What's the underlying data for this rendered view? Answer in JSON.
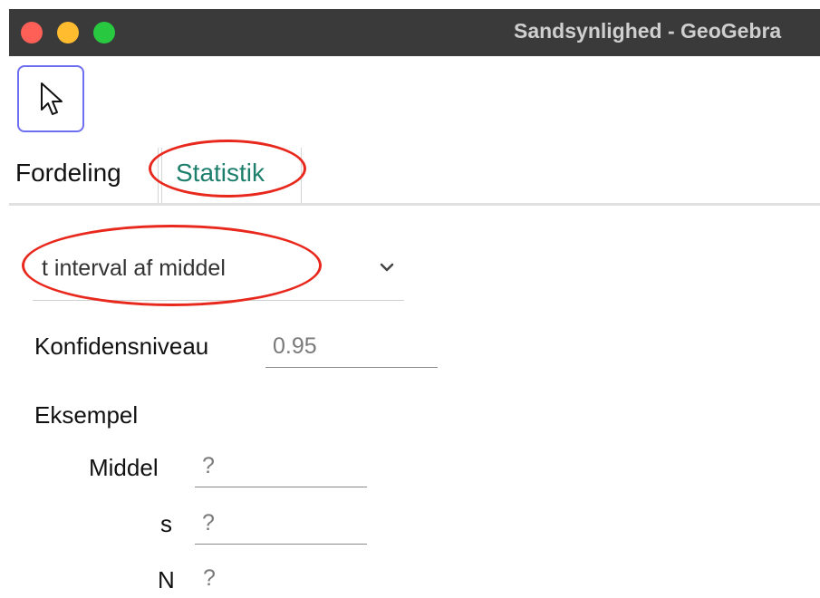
{
  "window": {
    "title": "Sandsynlighed - GeoGebra"
  },
  "tabs": [
    {
      "label": "Fordeling"
    },
    {
      "label": "Statistik"
    }
  ],
  "procedure": {
    "selected": "t interval af middel"
  },
  "confidence": {
    "label": "Konfidensniveau",
    "value": "0.95"
  },
  "sample": {
    "heading": "Eksempel",
    "mean": {
      "label": "Middel",
      "value": "?"
    },
    "sd": {
      "label": "s",
      "value": "?"
    },
    "n": {
      "label": "N",
      "value": "?"
    }
  },
  "colors": {
    "active_tab": "#1e7f6c",
    "annotation": "#e8281d",
    "tool_border": "#6e6ef0"
  },
  "icons": [
    "pointer-arrow-icon",
    "chevron-down-icon"
  ]
}
